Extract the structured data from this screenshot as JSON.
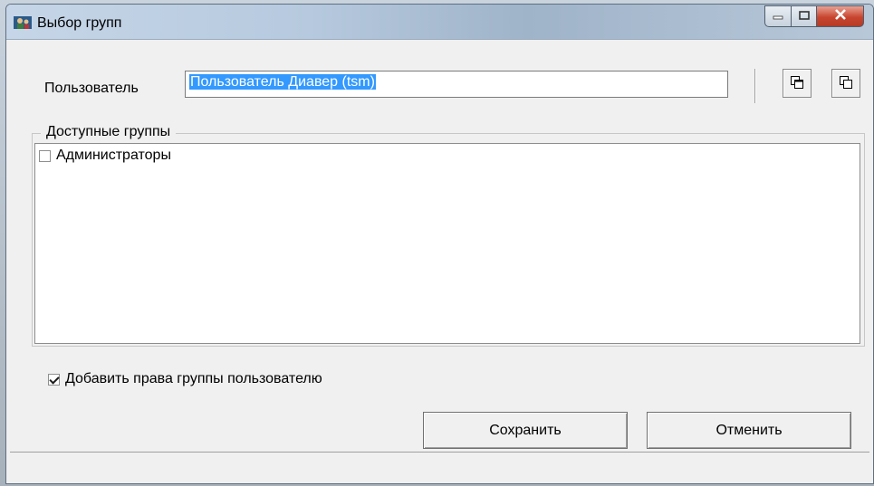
{
  "window": {
    "title": "Выбор групп",
    "icons": {
      "app": "app-users-icon",
      "minimize": "minimize-icon",
      "maximize": "maximize-icon",
      "close": "close-icon"
    }
  },
  "form": {
    "user_label": "Пользователь",
    "user_value": "Пользователь Диавер (tsm)",
    "tool_buttons": [
      "copy-windows-icon",
      "restore-windows-icon"
    ]
  },
  "groups": {
    "legend": "Доступные группы",
    "items": [
      {
        "label": "Администраторы",
        "checked": false
      }
    ]
  },
  "options": {
    "add_rights_label": "Добавить права группы пользователю",
    "add_rights_checked": true
  },
  "buttons": {
    "save": "Сохранить",
    "cancel": "Отменить"
  },
  "colors": {
    "selection": "#3399ff",
    "close_button": "#c8452f"
  }
}
